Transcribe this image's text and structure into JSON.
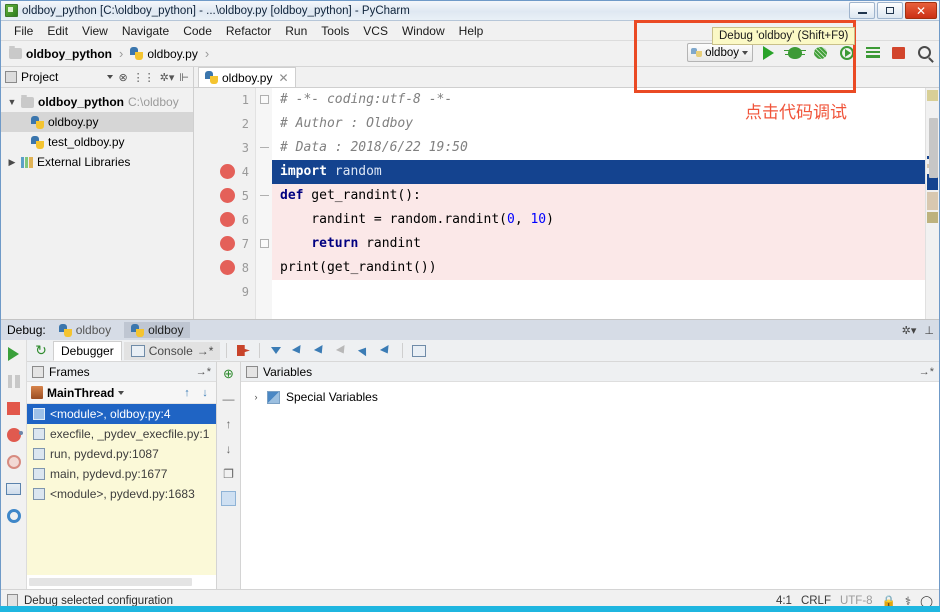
{
  "window": {
    "title": "oldboy_python [C:\\oldboy_python] - ...\\oldboy.py [oldboy_python] - PyCharm",
    "minimize": "—",
    "maximize": "▢",
    "close": "✕"
  },
  "menu": {
    "items": [
      "File",
      "Edit",
      "View",
      "Navigate",
      "Code",
      "Refactor",
      "Run",
      "Tools",
      "VCS",
      "Window",
      "Help"
    ]
  },
  "breadcrumb": {
    "project": "oldboy_python",
    "file": "oldboy.py",
    "separator": "›"
  },
  "toolbar": {
    "run_config": "oldboy",
    "tooltip": "Debug 'oldboy' (Shift+F9)",
    "annotation": "点击代码调试",
    "buttons": [
      "run",
      "debug",
      "debug-with-coverage",
      "run-with-coverage",
      "profile",
      "stop",
      "search"
    ]
  },
  "sidebar": {
    "title": "Project",
    "items": [
      {
        "label": "oldboy_python",
        "path": "C:\\oldboy",
        "type": "folder",
        "expanded": true
      },
      {
        "label": "oldboy.py",
        "type": "python",
        "selected": true
      },
      {
        "label": "test_oldboy.py",
        "type": "python",
        "selected": false
      },
      {
        "label": "External Libraries",
        "type": "library",
        "expanded": false
      }
    ]
  },
  "editor": {
    "tab": "oldboy.py",
    "close_label": "✕",
    "lines": [
      {
        "n": "1",
        "text": "# -*- coding:utf-8 -*-",
        "style": "comment",
        "breakpoint": false
      },
      {
        "n": "2",
        "text": "# Author : Oldboy",
        "style": "comment",
        "breakpoint": false
      },
      {
        "n": "3",
        "text": "# Data : 2018/6/22 19:50",
        "style": "comment",
        "breakpoint": false
      },
      {
        "n": "4",
        "text": "import random",
        "style": "current",
        "breakpoint": true
      },
      {
        "n": "5",
        "text": "def get_randint():",
        "style": "code",
        "breakpoint": true
      },
      {
        "n": "6",
        "text": "    randint = random.randint(0, 10)",
        "style": "code",
        "breakpoint": true
      },
      {
        "n": "7",
        "text": "    return randint",
        "style": "code",
        "breakpoint": true
      },
      {
        "n": "8",
        "text": "print(get_randint())",
        "style": "code",
        "breakpoint": true
      },
      {
        "n": "9",
        "text": "",
        "style": "code",
        "breakpoint": false
      }
    ]
  },
  "debug": {
    "label": "Debug:",
    "tabs": [
      {
        "label": "oldboy",
        "active": false
      },
      {
        "label": "oldboy",
        "active": true
      }
    ],
    "inner_tabs": [
      {
        "label": "Debugger",
        "active": true
      },
      {
        "label": "Console",
        "active": false,
        "suffix": "→*"
      }
    ],
    "left_rail": [
      "resume-program",
      "pause-program",
      "stop",
      "view-breakpoints",
      "mute-breakpoints",
      "restore-layout",
      "settings"
    ],
    "step_buttons": [
      "show-execution-point",
      "step-over",
      "step-into",
      "step-into-my-code",
      "force-step-into",
      "step-out",
      "run-to-cursor",
      "evaluate-expression"
    ],
    "frames": {
      "title": "Frames",
      "thread": "MainThread",
      "items": [
        {
          "label": "<module>, oldboy.py:4",
          "selected": true
        },
        {
          "label": "execfile, _pydev_execfile.py:1",
          "selected": false
        },
        {
          "label": "run, pydevd.py:1087",
          "selected": false
        },
        {
          "label": "main, pydevd.py:1677",
          "selected": false
        },
        {
          "label": "<module>, pydevd.py:1683",
          "selected": false
        }
      ]
    },
    "variables": {
      "title": "Variables",
      "items": [
        {
          "label": "Special Variables",
          "expander": "›"
        }
      ]
    }
  },
  "statusbar": {
    "message": "Debug selected configuration",
    "caret": "4:1",
    "line_sep": "CRLF",
    "encoding": "UTF-8"
  }
}
